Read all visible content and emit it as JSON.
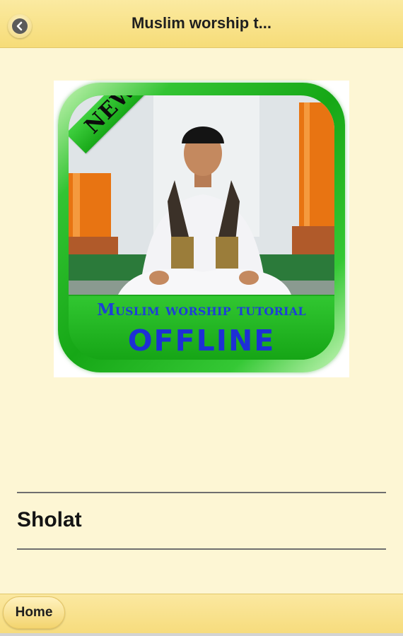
{
  "header": {
    "title": "Muslim worship t..."
  },
  "app_image": {
    "new_badge": "NEW",
    "banner_title": "Muslim worship tutorial",
    "banner_subtitle": "OFFLINE"
  },
  "section": {
    "title": "Sholat"
  },
  "footer": {
    "home_label": "Home"
  },
  "colors": {
    "header_bg": "#f6dc78",
    "page_bg": "#fdf6d4",
    "frame_green": "#16a716",
    "banner_text": "#1d3fd8"
  }
}
